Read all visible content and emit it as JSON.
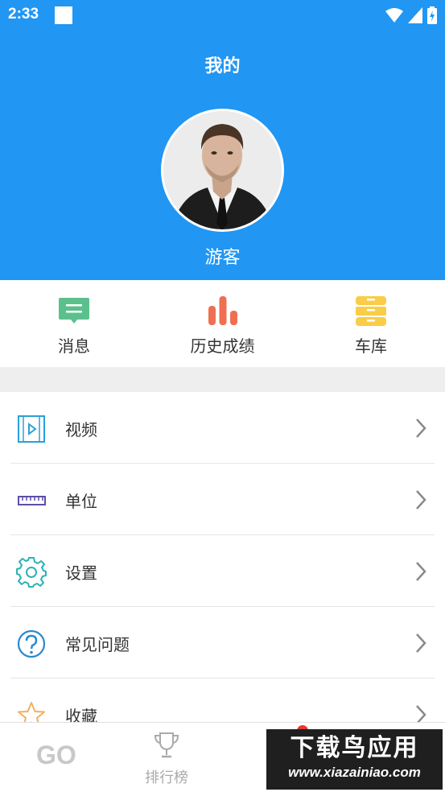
{
  "status_bar": {
    "time": "2:33"
  },
  "header": {
    "title": "我的",
    "username": "游客"
  },
  "quick_actions": [
    {
      "label": "消息",
      "icon": "message-icon",
      "color": "#5cc08c"
    },
    {
      "label": "历史成绩",
      "icon": "bar-chart-icon",
      "color": "#ef6f53"
    },
    {
      "label": "车库",
      "icon": "garage-icon",
      "color": "#f9cd48"
    }
  ],
  "menu": [
    {
      "label": "视频",
      "icon": "video-icon",
      "color": "#2aa0d8"
    },
    {
      "label": "单位",
      "icon": "ruler-icon",
      "color": "#5b4fa8"
    },
    {
      "label": "设置",
      "icon": "gear-icon",
      "color": "#2bb3b7"
    },
    {
      "label": "常见问题",
      "icon": "question-icon",
      "color": "#2a8ad0"
    },
    {
      "label": "收藏",
      "icon": "star-icon",
      "color": "#f1b062"
    }
  ],
  "bottom_nav": {
    "go_label": "GO",
    "ranking_label": "排行榜"
  },
  "watermark": {
    "title": "下载鸟应用",
    "url": "www.xiazainiao.com"
  },
  "colors": {
    "primary": "#2196f3",
    "badge": "#e53935"
  }
}
